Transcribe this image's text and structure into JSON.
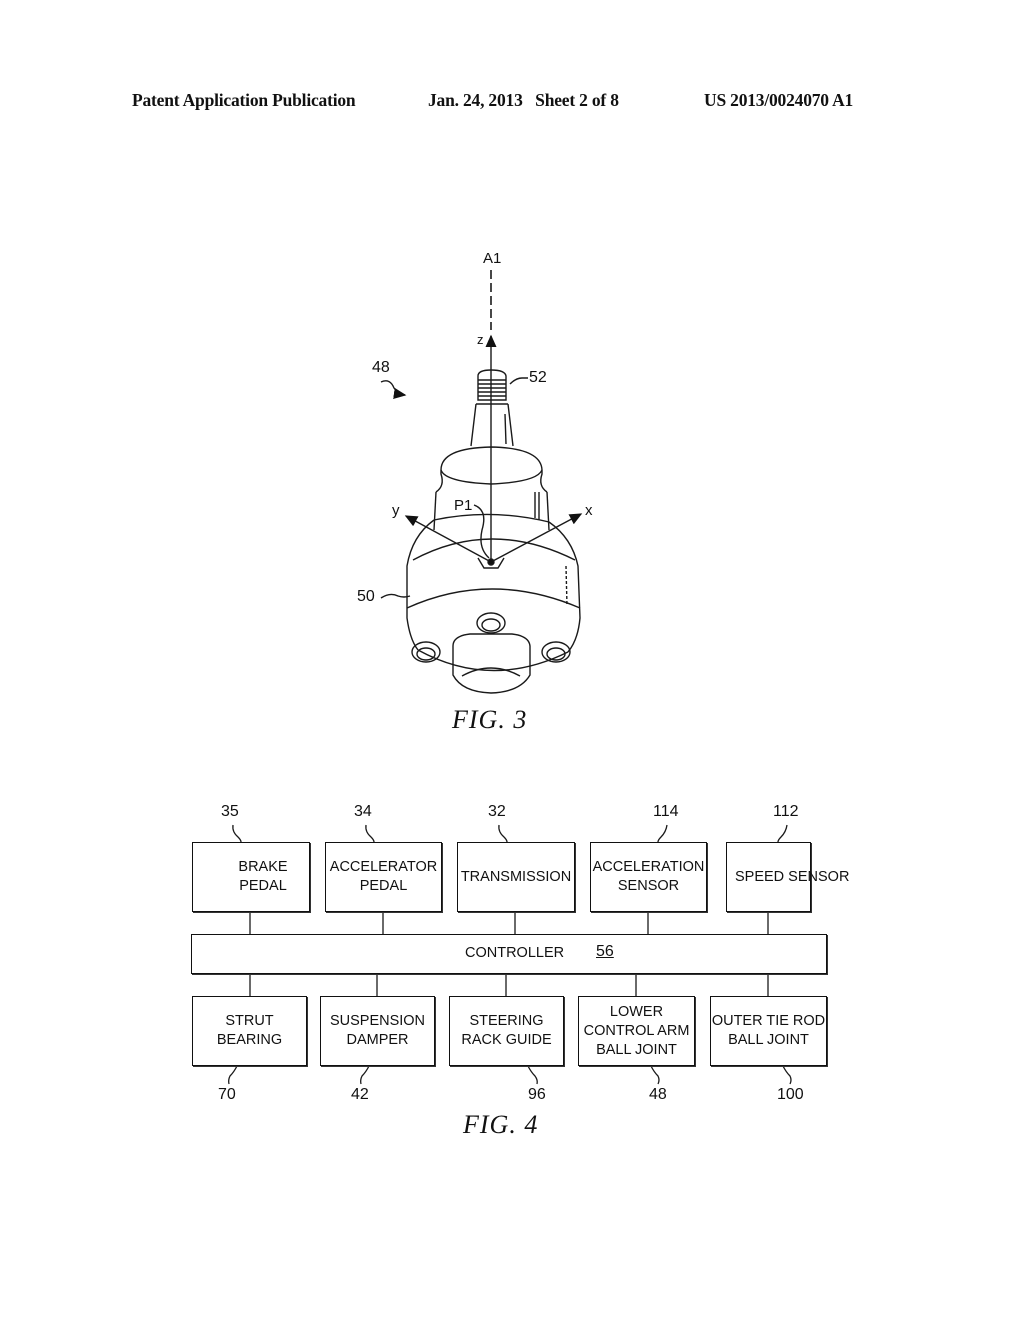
{
  "header": {
    "publication": "Patent Application Publication",
    "date_sheet": "Jan. 24, 2013   Sheet 2 of 8",
    "number": "US 2013/0024070 A1"
  },
  "fig3": {
    "caption": "FIG. 3",
    "labels": {
      "axis": "A1",
      "z": "z",
      "x": "x",
      "y": "y",
      "point": "P1",
      "assembly": "48",
      "stud": "52",
      "housing": "50"
    }
  },
  "fig4": {
    "caption": "FIG. 4",
    "controller": {
      "label": "CONTROLLER",
      "ref": "56"
    },
    "inputs": [
      {
        "label_lines": [
          "BRAKE PEDAL"
        ],
        "ref": "35"
      },
      {
        "label_lines": [
          "ACCELERATOR",
          "PEDAL"
        ],
        "ref": "34"
      },
      {
        "label_lines": [
          "TRANSMISSION"
        ],
        "ref": "32"
      },
      {
        "label_lines": [
          "ACCELERATION",
          "SENSOR"
        ],
        "ref": "114"
      },
      {
        "label_lines": [
          "SPEED SENSOR"
        ],
        "ref": "112"
      }
    ],
    "outputs": [
      {
        "label_lines": [
          "STRUT",
          "BEARING"
        ],
        "ref": "70"
      },
      {
        "label_lines": [
          "SUSPENSION",
          "DAMPER"
        ],
        "ref": "42"
      },
      {
        "label_lines": [
          "STEERING",
          "RACK GUIDE"
        ],
        "ref": "96"
      },
      {
        "label_lines": [
          "LOWER",
          "CONTROL ARM",
          "BALL JOINT"
        ],
        "ref": "48"
      },
      {
        "label_lines": [
          "OUTER TIE ROD",
          "BALL JOINT"
        ],
        "ref": "100"
      }
    ]
  }
}
